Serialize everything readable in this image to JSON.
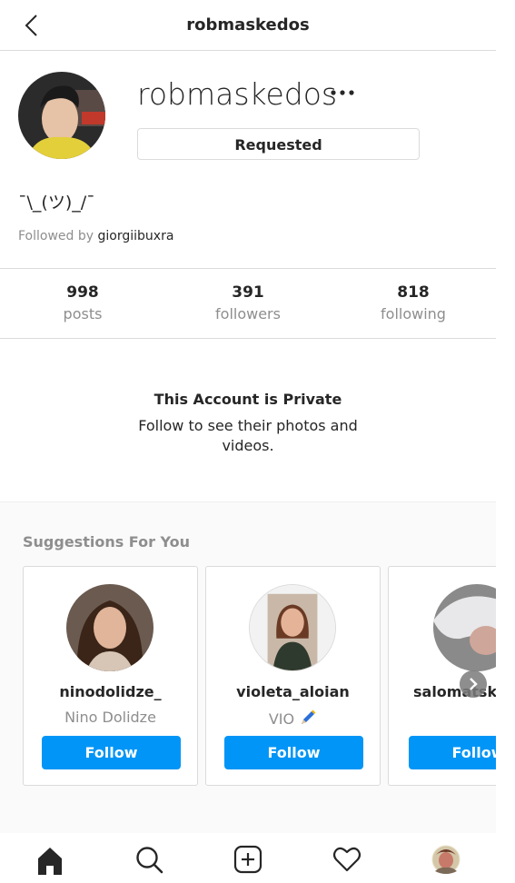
{
  "header": {
    "title": "robmaskedos"
  },
  "profile": {
    "username": "robmaskedos",
    "requested_label": "Requested",
    "bio": "¯\\_(ツ)_/¯",
    "followed_by_prefix": "Followed by",
    "followed_by_user": "giorgiibuxra"
  },
  "stats": [
    {
      "value": "998",
      "label": "posts"
    },
    {
      "value": "391",
      "label": "followers"
    },
    {
      "value": "818",
      "label": "following"
    }
  ],
  "private": {
    "title": "This Account is Private",
    "text": "Follow to see their photos and videos."
  },
  "suggestions": {
    "title": "Suggestions For You",
    "items": [
      {
        "username": "ninodolidze_",
        "name": "Nino Dolidze",
        "button": "Follow"
      },
      {
        "username": "violeta_aloian",
        "name": "VIO",
        "button": "Follow"
      },
      {
        "username": "salomatskep",
        "name": "",
        "button": "Follow"
      }
    ]
  },
  "nav": [
    "home-icon",
    "search-icon",
    "new-post-icon",
    "activity-heart-icon",
    "profile-avatar"
  ],
  "colors": {
    "accent": "#0095f6",
    "muted": "#8e8e8e",
    "border": "#dbdbdb"
  }
}
